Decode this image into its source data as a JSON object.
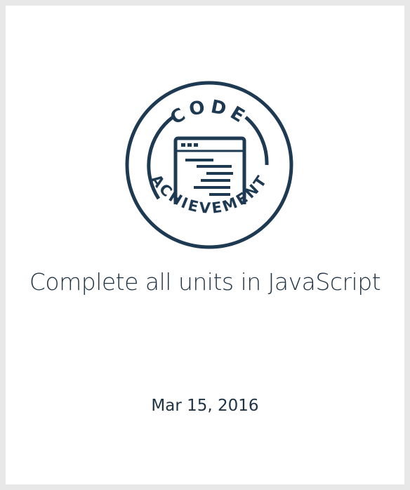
{
  "badge": {
    "top_text": "CODE",
    "bottom_text": "ACHIEVEMENT",
    "icon": "code-window-icon",
    "color": "#1e3a52"
  },
  "achievement": {
    "title": "Complete all units in JavaScript",
    "date": "Mar 15, 2016"
  }
}
